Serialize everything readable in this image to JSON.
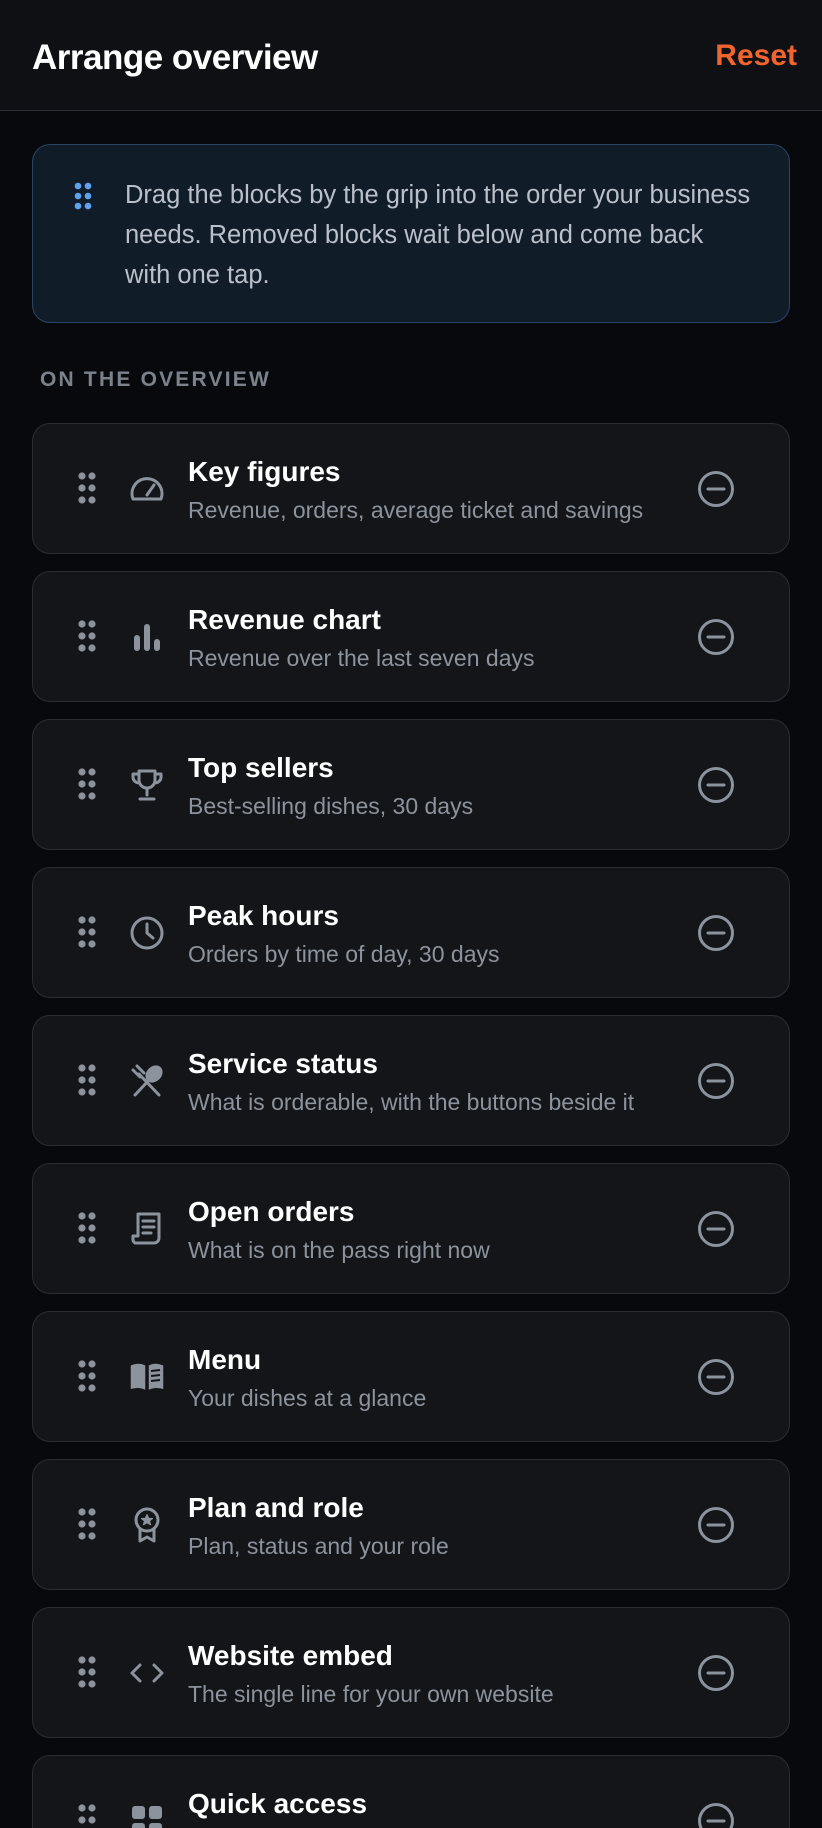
{
  "header": {
    "title": "Arrange overview",
    "reset_label": "Reset"
  },
  "info": {
    "text": "Drag the blocks by the grip into the order your business needs. Removed blocks wait below and come back with one tap.",
    "icon": "grip-icon"
  },
  "section": {
    "label": "ON THE OVERVIEW"
  },
  "colors": {
    "accent": "#f0652f",
    "info_icon": "#5fa3ee",
    "muted_icon": "#8d939c"
  },
  "blocks": [
    {
      "title": "Key figures",
      "desc": "Revenue, orders, average ticket and savings",
      "icon": "gauge-icon"
    },
    {
      "title": "Revenue chart",
      "desc": "Revenue over the last seven days",
      "icon": "bar-chart-icon"
    },
    {
      "title": "Top sellers",
      "desc": "Best-selling dishes, 30 days",
      "icon": "trophy-icon"
    },
    {
      "title": "Peak hours",
      "desc": "Orders by time of day, 30 days",
      "icon": "clock-icon"
    },
    {
      "title": "Service status",
      "desc": "What is orderable, with the buttons beside it",
      "icon": "utensils-icon"
    },
    {
      "title": "Open orders",
      "desc": "What is on the pass right now",
      "icon": "receipt-icon"
    },
    {
      "title": "Menu",
      "desc": "Your dishes at a glance",
      "icon": "book-open-icon"
    },
    {
      "title": "Plan and role",
      "desc": "Plan, status and your role",
      "icon": "award-badge-icon"
    },
    {
      "title": "Website embed",
      "desc": "The single line for your own website",
      "icon": "code-icon"
    },
    {
      "title": "Quick access",
      "desc": "",
      "icon": "grid-icon"
    }
  ]
}
